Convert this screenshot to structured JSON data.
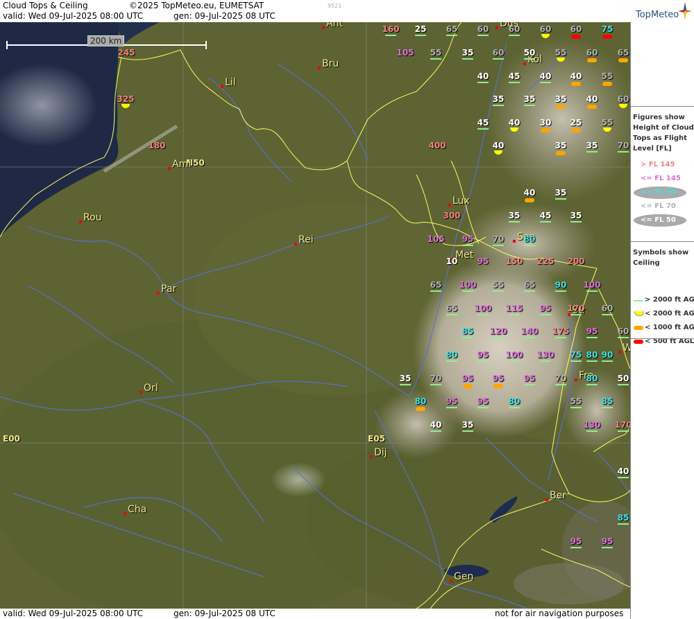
{
  "header": {
    "title": "Cloud Tops & Ceiling",
    "copyright": "©2025 TopMeteo.eu, EUMETSAT",
    "code": "9521",
    "valid": "valid:  Wed   09-Jul-2025   08:00 UTC",
    "gen": "gen: 09-Jul-2025 08 UTC",
    "logo": "TopMeteo"
  },
  "footer": {
    "valid": "valid:  Wed   09-Jul-2025   08:00 UTC",
    "gen": "gen: 09-Jul-2025 08 UTC",
    "disclaimer": "not for air navigation purposes"
  },
  "scale": {
    "label": "200 km"
  },
  "gridlabels": [
    "N50",
    "E00",
    "E05"
  ],
  "cities": [
    "Ant",
    "Bru",
    "Lil",
    "Ami",
    "Rou",
    "Rei",
    "Par",
    "Orl",
    "Cha",
    "Dij",
    "Lux",
    "Saa",
    "Met",
    "Str",
    "Fre",
    "Ber",
    "Gen",
    "Köl",
    "Düs",
    "W"
  ],
  "legend": {
    "tops_title": "Figures show Height of Cloud Tops as Flight Level [FL]",
    "tops": [
      {
        "label": "> FL 145",
        "color": "#f08080",
        "oval": false
      },
      {
        "label": "<= FL 145",
        "color": "#da70d6",
        "oval": false
      },
      {
        "label": "<= FL 90",
        "color": "#40e0e0",
        "oval": true
      },
      {
        "label": "<= FL 70",
        "color": "#b0b0b0",
        "oval": false
      },
      {
        "label": "<= FL 50",
        "color": "#ffffff",
        "oval": true
      }
    ],
    "ceiling_title": "Symbols show Ceiling",
    "ceiling": [
      {
        "label": "> 2000 ft AGL",
        "type": "line",
        "color": "#90ee90"
      },
      {
        "label": "< 2000 ft AGL",
        "type": "half",
        "color": "#ffff00"
      },
      {
        "label": "< 1000 ft AGL",
        "type": "pill",
        "color": "#ffa500"
      },
      {
        "label": "< 500 ft AGL",
        "type": "pill",
        "color": "#ff0000"
      }
    ]
  },
  "flight_levels": [
    {
      "v": "160",
      "s": "green"
    },
    {
      "v": "25",
      "s": "green"
    },
    {
      "v": "65",
      "s": "green"
    },
    {
      "v": "60",
      "s": "green"
    },
    {
      "v": "60",
      "s": "green"
    },
    {
      "v": "60",
      "s": "yellow"
    },
    {
      "v": "60",
      "s": "red"
    },
    {
      "v": "75",
      "s": "red"
    },
    {
      "v": "245",
      "s": "none"
    },
    {
      "v": "105",
      "s": "none"
    },
    {
      "v": "55",
      "s": "green"
    },
    {
      "v": "35",
      "s": "green"
    },
    {
      "v": "60",
      "s": "green"
    },
    {
      "v": "50",
      "s": "green"
    },
    {
      "v": "55",
      "s": "yellow"
    },
    {
      "v": "60",
      "s": "orange"
    },
    {
      "v": "65",
      "s": "orange"
    },
    {
      "v": "40",
      "s": "green"
    },
    {
      "v": "45",
      "s": "green"
    },
    {
      "v": "40",
      "s": "green"
    },
    {
      "v": "40",
      "s": "orange"
    },
    {
      "v": "55",
      "s": "orange"
    },
    {
      "v": "325",
      "s": "yellow"
    },
    {
      "v": "35",
      "s": "green"
    },
    {
      "v": "35",
      "s": "green"
    },
    {
      "v": "35",
      "s": "orange"
    },
    {
      "v": "40",
      "s": "orange"
    },
    {
      "v": "60",
      "s": "yellow"
    },
    {
      "v": "45",
      "s": "green"
    },
    {
      "v": "40",
      "s": "yellow"
    },
    {
      "v": "30",
      "s": "orange"
    },
    {
      "v": "25",
      "s": "orange"
    },
    {
      "v": "55",
      "s": "yellow"
    },
    {
      "v": "180",
      "s": "none"
    },
    {
      "v": "400",
      "s": "none"
    },
    {
      "v": "40",
      "s": "yellow"
    },
    {
      "v": "35",
      "s": "orange"
    },
    {
      "v": "35",
      "s": "green"
    },
    {
      "v": "70",
      "s": "green"
    },
    {
      "v": "40",
      "s": "orange"
    },
    {
      "v": "35",
      "s": "green"
    },
    {
      "v": "300",
      "s": "none"
    },
    {
      "v": "35",
      "s": "green"
    },
    {
      "v": "45",
      "s": "green"
    },
    {
      "v": "35",
      "s": "green"
    },
    {
      "v": "105",
      "s": "none"
    },
    {
      "v": "95",
      "s": "green"
    },
    {
      "v": "70",
      "s": "green"
    },
    {
      "v": "80",
      "s": "green"
    },
    {
      "v": "10",
      "s": "none"
    },
    {
      "v": "95",
      "s": "none"
    },
    {
      "v": "150",
      "s": "none"
    },
    {
      "v": "225",
      "s": "none"
    },
    {
      "v": "200",
      "s": "none"
    },
    {
      "v": "65",
      "s": "green"
    },
    {
      "v": "100",
      "s": "green"
    },
    {
      "v": "55",
      "s": "green"
    },
    {
      "v": "65",
      "s": "green"
    },
    {
      "v": "90",
      "s": "green"
    },
    {
      "v": "100",
      "s": "green"
    },
    {
      "v": "65",
      "s": "green"
    },
    {
      "v": "100",
      "s": "green"
    },
    {
      "v": "115",
      "s": "green"
    },
    {
      "v": "95",
      "s": "green"
    },
    {
      "v": "170",
      "s": "green"
    },
    {
      "v": "60",
      "s": "green"
    },
    {
      "v": "85",
      "s": "green"
    },
    {
      "v": "120",
      "s": "green"
    },
    {
      "v": "140",
      "s": "green"
    },
    {
      "v": "175",
      "s": "green"
    },
    {
      "v": "95",
      "s": "green"
    },
    {
      "v": "60",
      "s": "green"
    },
    {
      "v": "80",
      "s": "green"
    },
    {
      "v": "95",
      "s": "green"
    },
    {
      "v": "100",
      "s": "green"
    },
    {
      "v": "130",
      "s": "green"
    },
    {
      "v": "75",
      "s": "green"
    },
    {
      "v": "80",
      "s": "green"
    },
    {
      "v": "90",
      "s": "green"
    },
    {
      "v": "35",
      "s": "green"
    },
    {
      "v": "70",
      "s": "green"
    },
    {
      "v": "95",
      "s": "orange"
    },
    {
      "v": "95",
      "s": "orange"
    },
    {
      "v": "95",
      "s": "green"
    },
    {
      "v": "70",
      "s": "green"
    },
    {
      "v": "80",
      "s": "green"
    },
    {
      "v": "50",
      "s": "green"
    },
    {
      "v": "80",
      "s": "orange"
    },
    {
      "v": "95",
      "s": "green"
    },
    {
      "v": "95",
      "s": "green"
    },
    {
      "v": "80",
      "s": "green"
    },
    {
      "v": "55",
      "s": "green"
    },
    {
      "v": "85",
      "s": "green"
    },
    {
      "v": "40",
      "s": "green"
    },
    {
      "v": "35",
      "s": "green"
    },
    {
      "v": "130",
      "s": "green"
    },
    {
      "v": "170",
      "s": "green"
    },
    {
      "v": "40",
      "s": "green"
    },
    {
      "v": "85",
      "s": "green"
    },
    {
      "v": "95",
      "s": "green"
    },
    {
      "v": "95",
      "s": "green"
    }
  ],
  "colors": {
    "land": "#5d6332",
    "sea": "#1e2a45",
    "border": "#ffff66",
    "river": "#5b6fd8",
    "fl_high": "#f08080",
    "fl_mid": "#da70d6",
    "fl_low": "#40e0e0",
    "fl_vlow": "#b0b0b0",
    "fl_min": "#ffffff"
  }
}
